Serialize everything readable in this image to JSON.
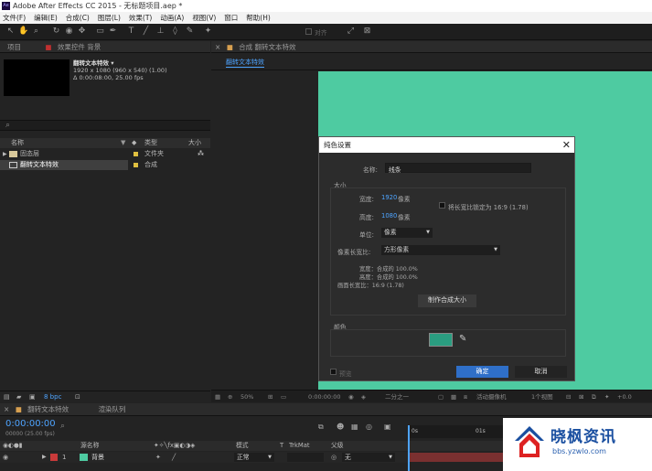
{
  "window": {
    "title": "Adobe After Effects CC 2015 - 无标题项目.aep *",
    "app_icon": "Ae"
  },
  "menu": [
    "文件(F)",
    "编辑(E)",
    "合成(C)",
    "图层(L)",
    "效果(T)",
    "动画(A)",
    "视图(V)",
    "窗口",
    "帮助(H)"
  ],
  "toolbar": {
    "align_label": "对齐"
  },
  "project_panel": {
    "tab_label": "项目",
    "effects_tab": "效果控件 背景",
    "comp_name": "翻转文本特效 ▾",
    "comp_info1": "1920 x 1080  (960 x 540) (1.00)",
    "comp_info2": "Δ 0:00:08:00, 25.00 fps",
    "search_icon_char": "⌕",
    "col_name": "名称",
    "col_type": "类型",
    "col_size": "大小",
    "rows": [
      {
        "name": "固态层",
        "type": "文件夹",
        "color": "#e0c040"
      },
      {
        "name": "翻转文本特效",
        "type": "合成",
        "color": "#e0c040"
      }
    ],
    "bpc": "8 bpc"
  },
  "viewer": {
    "tab_label": "合成 翻转文本特效",
    "sub_tab": "翻转文本特效",
    "bg_color": "#4ecba1",
    "zoom": "50%",
    "timecode": "0:00:00:00",
    "resolution": "二分之一",
    "camera": "活动摄像机",
    "views": "1个视图",
    "exposure": "+0.0"
  },
  "dialog": {
    "title": "纯色设置",
    "close_char": "✕",
    "name_label": "名称:",
    "name_value": "线条",
    "size_group": "大小",
    "width_label": "宽度:",
    "width_value": "1920",
    "px1": "像素",
    "height_label": "高度:",
    "height_value": "1080",
    "px2": "像素",
    "lock_aspect": "将长宽比锁定为 16:9 (1.78)",
    "unit_label": "单位:",
    "unit_value": "像素",
    "par_label": "像素长宽比:",
    "par_value": "方形像素",
    "info_width": "宽度：合成的 100.0%",
    "info_height": "高度：合成的 100.0%",
    "info_frame": "画面长宽比：16:9 (1.78)",
    "make_comp_size": "制作合成大小",
    "color_group": "颜色",
    "color_swatch": "#2a9d80",
    "preview_label": "预览",
    "ok": "确定",
    "cancel": "取消"
  },
  "timeline": {
    "tab_label": "翻转文本特效",
    "render_tab": "渲染队列",
    "timecode": "0:00:00:00",
    "fps_info": "00000 (25.00 fps)",
    "col_source": "源名称",
    "col_mode": "模式",
    "col_t": "T",
    "col_trkmat": "TrkMat",
    "col_parent": "父级",
    "ruler_0": "0s",
    "ruler_1": "01s",
    "layer": {
      "num": "1",
      "name": "背景",
      "mode": "正常",
      "parent": "无",
      "label_color": "#c83a3a"
    }
  },
  "watermark": {
    "title": "晓枫资讯",
    "url": "bbs.yzwlo.com"
  }
}
